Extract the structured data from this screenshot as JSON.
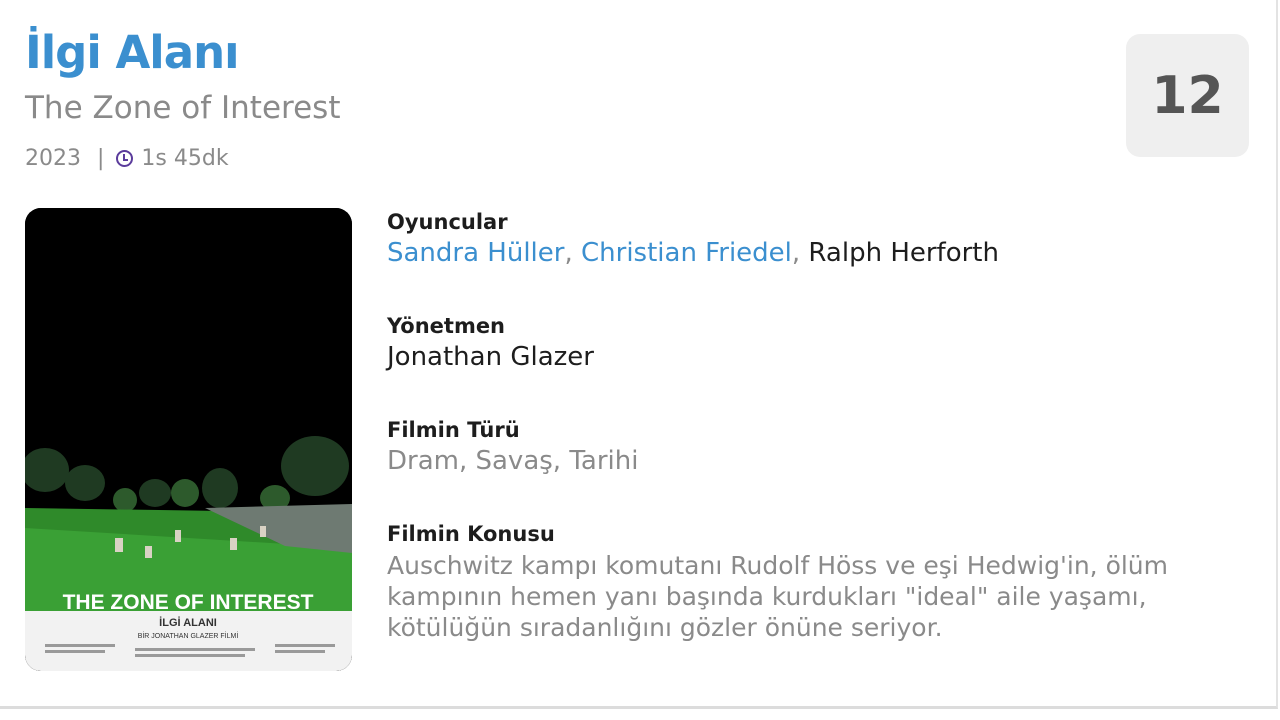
{
  "movie": {
    "title": "İlgi Alanı",
    "original_title": "The Zone of Interest",
    "year": "2023",
    "separator": "|",
    "duration": "1s 45dk",
    "age_rating": "12"
  },
  "poster": {
    "headline": "THE ZONE OF INTEREST",
    "subtitle": "İLGİ ALANI",
    "credit": "BİR JONATHAN GLAZER FİLMİ"
  },
  "details": {
    "cast_label": "Oyuncular",
    "cast": [
      "Sandra Hüller",
      "Christian Friedel",
      "Ralph Herforth"
    ],
    "cast_sep": ", ",
    "director_label": "Yönetmen",
    "director": "Jonathan Glazer",
    "genre_label": "Filmin Türü",
    "genre": "Dram, Savaş, Tarihi",
    "plot_label": "Filmin Konusu",
    "plot": "Auschwitz kampı komutanı Rudolf Höss ve eşi Hedwig'in, ölüm kampının hemen yanı başında kurdukları \"ideal\" aile yaşamı, kötülüğün sıradanlığını gözler önüne seriyor."
  },
  "colors": {
    "title": "#3b8fcf",
    "link": "#3b8fcf",
    "muted": "#8a8a8a",
    "clock": "#5b3c9c",
    "badge_bg": "#efefef"
  },
  "icons": {
    "duration": "clock-icon"
  }
}
